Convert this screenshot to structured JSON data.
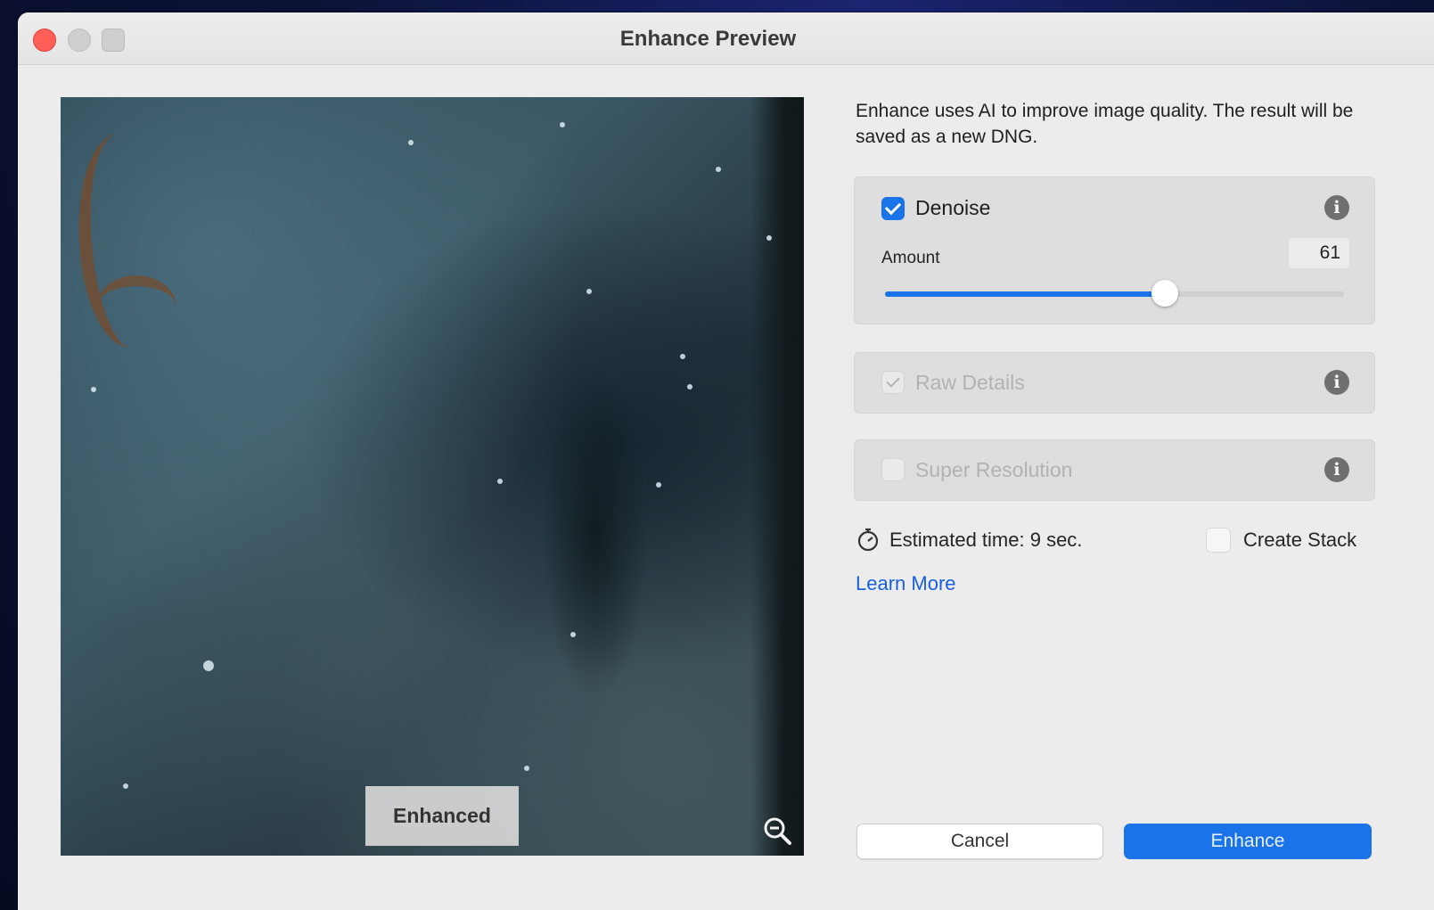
{
  "window": {
    "title": "Enhance Preview"
  },
  "preview": {
    "badge": "Enhanced",
    "zoom_icon": "zoom-out-icon"
  },
  "panel": {
    "description": "Enhance uses AI to improve image quality. The result will be saved as a new DNG.",
    "denoise": {
      "label": "Denoise",
      "checked": true,
      "amount_label": "Amount",
      "amount": "61",
      "amount_fraction": 0.61
    },
    "raw_details": {
      "label": "Raw Details",
      "checked": true,
      "enabled": false
    },
    "super_resolution": {
      "label": "Super Resolution",
      "checked": false,
      "enabled": false
    },
    "estimate": "Estimated time: 9 sec.",
    "create_stack": {
      "label": "Create Stack",
      "checked": false
    },
    "learn_more": "Learn More"
  },
  "buttons": {
    "cancel": "Cancel",
    "enhance": "Enhance"
  },
  "colors": {
    "accent": "#1a73e8",
    "close": "#ff5f57",
    "link": "#1a5fe0"
  }
}
